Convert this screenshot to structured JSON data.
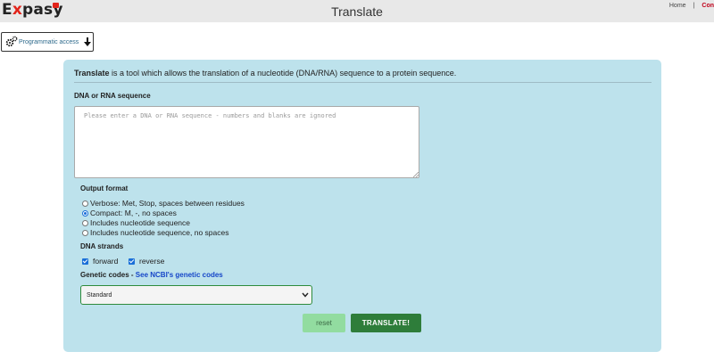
{
  "header": {
    "logo_prefix": "E",
    "logo_x": "x",
    "logo_suffix": "pasy",
    "page_title": "Translate",
    "links": {
      "home": "Home",
      "separator": "|",
      "contact": "Con"
    }
  },
  "programmatic": {
    "label": "Programmatic access",
    "icon": "gears-icon"
  },
  "intro": {
    "tool_name": "Translate",
    "text": " is a tool which allows the translation of a nucleotide (DNA/RNA) sequence to a protein sequence."
  },
  "sequence": {
    "label": "DNA or RNA sequence",
    "placeholder": "Please enter a DNA or RNA sequence - numbers and blanks are ignored",
    "value": ""
  },
  "output_format": {
    "label": "Output format",
    "options": [
      {
        "label": "Verbose: Met, Stop, spaces between residues",
        "selected": false
      },
      {
        "label": "Compact: M, -, no spaces",
        "selected": true
      },
      {
        "label": "Includes nucleotide sequence",
        "selected": false
      },
      {
        "label": "Includes nucleotide sequence, no spaces",
        "selected": false
      }
    ]
  },
  "strands": {
    "label": "DNA strands",
    "forward": {
      "label": "forward",
      "checked": true
    },
    "reverse": {
      "label": "reverse",
      "checked": true
    }
  },
  "genetic_codes": {
    "label": "Genetic codes - ",
    "link": "See NCBI's genetic codes",
    "selected": "Standard"
  },
  "buttons": {
    "reset": "reset",
    "translate": "TRANSLATE!"
  },
  "colors": {
    "panel": "#bde2ec",
    "translate": "#2e7d3a",
    "reset": "#92dca0",
    "brand_red": "#e2231a"
  }
}
